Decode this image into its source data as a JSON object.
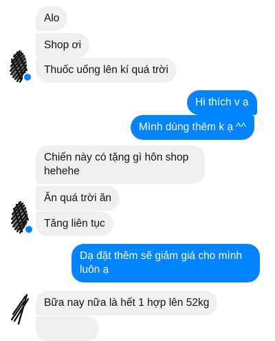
{
  "conversation": {
    "messages": [
      {
        "sender": "shop-customer",
        "text": "Alo"
      },
      {
        "sender": "shop-customer",
        "text": "Shop ơi"
      },
      {
        "sender": "shop-customer",
        "text": "Thuốc uống lên kí quá trời"
      },
      {
        "sender": "shop",
        "text": "Hi thích v ạ"
      },
      {
        "sender": "shop",
        "text": "Mình dùng thêm k ạ ^^"
      },
      {
        "sender": "shop-customer",
        "text": "Chiến này có tặng gì hôn shop hehehe"
      },
      {
        "sender": "shop-customer",
        "text": "Ăn quá trời ăn"
      },
      {
        "sender": "shop-customer",
        "text": "Tăng liên tục"
      },
      {
        "sender": "shop",
        "text": "Dạ đặt thêm sẽ giảm giá cho mình luôn ạ"
      },
      {
        "sender": "shop-customer",
        "text": "Bữa nay nữa là hết 1 hợp  lên 52kg"
      },
      {
        "sender": "shop-customer",
        "text": ""
      }
    ]
  },
  "colors": {
    "outgoing_bubble": "#0084ff",
    "incoming_bubble": "#f1f0f0",
    "scribble": "#111111"
  },
  "icons": [
    "avatar-scribble-icon",
    "seen-badge-icon"
  ]
}
